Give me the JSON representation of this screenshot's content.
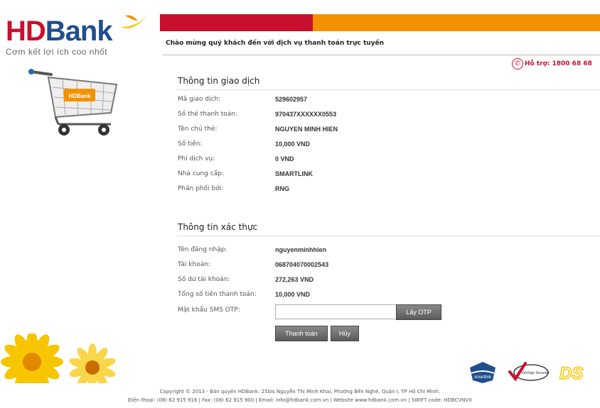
{
  "brand": {
    "name_part1": "HD",
    "name_part2": "Bank",
    "slogan": "Cơm kết lợi ích coo nhốt",
    "cart_badge": "HDBank",
    "colors": {
      "red": "#c8102e",
      "orange": "#f39200",
      "blue": "#1f4e8c",
      "yellow": "#f7c600"
    }
  },
  "header": {
    "welcome": "Chào mừng quý khách đến với dịch vụ thanh toán trực tuyến",
    "hotline": "Hỗ trợ: 1800 68 68"
  },
  "transaction": {
    "title": "Thông tin giao dịch",
    "rows": [
      {
        "label": "Mã giao dịch:",
        "value": "529602957"
      },
      {
        "label": "Số thẻ thanh toán:",
        "value": "970437XXXXXX0553"
      },
      {
        "label": "Tên chủ thẻ:",
        "value": "NGUYEN MINH HIEN"
      },
      {
        "label": "Số tiền:",
        "value": "10,000 VND"
      },
      {
        "label": "Phí dịch vụ:",
        "value": "0 VND"
      },
      {
        "label": "Nhà cung cấp:",
        "value": "SMARTLINK"
      },
      {
        "label": "Phân phối bởi:",
        "value": "RNG"
      }
    ]
  },
  "auth": {
    "title": "Thông tin xác thực",
    "rows": [
      {
        "label": "Tên đăng nhập:",
        "value": "nguyenminhhien"
      },
      {
        "label": "Tài khoản:",
        "value": "068704070002543"
      },
      {
        "label": "Số dư tài khoản:",
        "value": "272,263 VND"
      },
      {
        "label": "Tổng số tiền thanh toán:",
        "value": "10,000 VND"
      }
    ],
    "otp_label": "Mật khẩu SMS OTP:",
    "otp_value": "",
    "get_otp_button": "Lấy OTP",
    "pay_button": "Thanh toán",
    "cancel_button": "Hủy"
  },
  "partners": [
    "smartlink",
    "VeriSign Secured",
    "DS"
  ],
  "footer": {
    "line1": "Copyright © 2013 - Bản quyền HDBank: 25bis Nguyễn Thị Minh Khai, Phường Bến Nghé, Quận I, TP Hồ Chí Minh.",
    "line2": "Điện thoại: (08) 62 915 916 | Fax: (08) 62 915 900 | Email: info@hdbank.com.vn | Website www.hdbank.com.vn | SWIFT code: HDBCVNVX"
  }
}
